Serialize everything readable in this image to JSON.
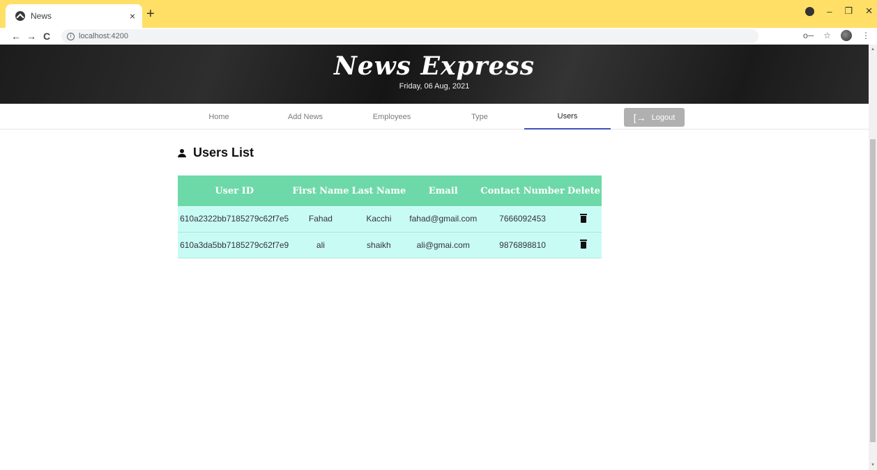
{
  "browser": {
    "tab_title": "News",
    "tab_close": "×",
    "new_tab": "+",
    "url": "localhost:4200",
    "back": "←",
    "forward": "→",
    "reload": "C",
    "key_icon": "o─",
    "star_icon": "☆",
    "menu_icon": "⋮",
    "minimize": "–",
    "restore": "❐",
    "close": "✕"
  },
  "header": {
    "brand": "News Express",
    "date": "Friday, 06 Aug, 2021"
  },
  "nav": {
    "items": [
      {
        "label": "Home"
      },
      {
        "label": "Add News"
      },
      {
        "label": "Employees"
      },
      {
        "label": "Type"
      },
      {
        "label": "Users"
      }
    ],
    "active": "Users",
    "logout_label": "Logout",
    "logout_icon": "[→"
  },
  "users_section": {
    "title": "Users List",
    "columns": [
      "User ID",
      "First Name",
      "Last Name",
      "Email",
      "Contact Number",
      "Delete"
    ],
    "rows": [
      {
        "user_id": "610a2322bb7185279c62f7e5",
        "first_name": "Fahad",
        "last_name": "Kacchi",
        "email": "fahad@gmail.com",
        "contact": "7666092453"
      },
      {
        "user_id": "610a3da5bb7185279c62f7e9",
        "first_name": "ali",
        "last_name": "shaikh",
        "email": "ali@gmai.com",
        "contact": "9876898810"
      }
    ]
  },
  "colors": {
    "tabstrip": "#ffdf66",
    "table_header": "#6ed9a8",
    "table_row": "#c9fbf5",
    "active_tab_underline": "#3f51b5",
    "logout_button": "#b0b0b0"
  }
}
